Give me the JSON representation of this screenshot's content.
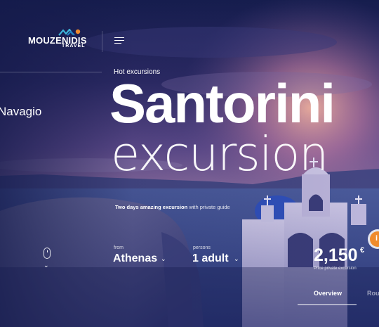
{
  "brand": {
    "name": "MOUZENIDIS",
    "sub": "TRAVEL"
  },
  "side": {
    "destination": "Navagio"
  },
  "hero": {
    "eyebrow": "Hot excursions",
    "title": "Santorini",
    "subtitle": "excursion",
    "tagline_bold": "Two days amazing excursion",
    "tagline_rest": " with private guide"
  },
  "booking": {
    "from_label": "from",
    "from_value": "Athenas",
    "persons_label": "persons",
    "persons_value": "1 adult"
  },
  "price": {
    "value": "2,150",
    "currency": "€",
    "label": "Price private excursion"
  },
  "tabs": [
    {
      "label": "Overview"
    },
    {
      "label": "Rou"
    }
  ],
  "badge": {
    "text": "i"
  },
  "colors": {
    "accent": "#ef8b2c",
    "sky_top": "#1b2354",
    "sky_mid": "#6b4a8f",
    "glow": "#f0a59a"
  }
}
